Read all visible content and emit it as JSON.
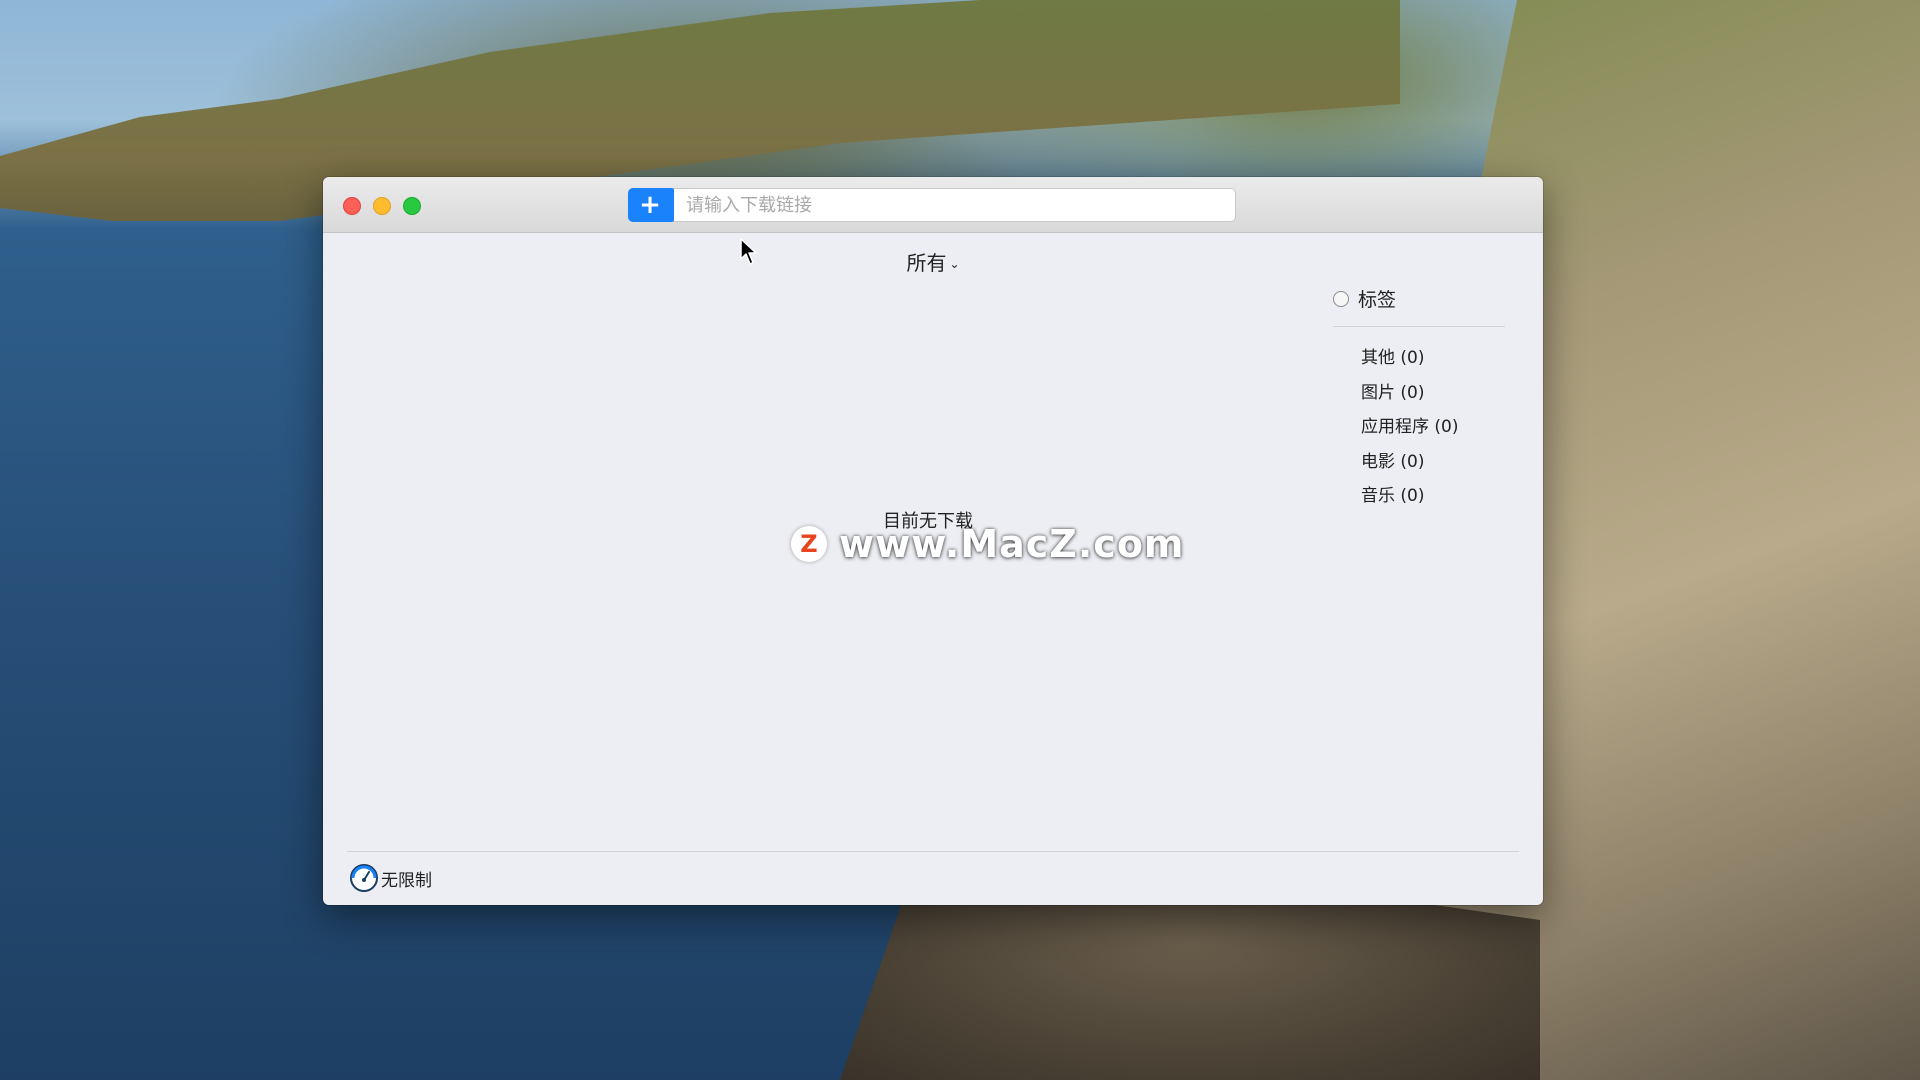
{
  "app": {
    "input_placeholder": "请输入下载链接",
    "filter_label": "所有",
    "empty_message": "目前无下载",
    "speed_label": "无限制",
    "accent_color": "#1a82fb"
  },
  "sidebar": {
    "header": "标签",
    "items": [
      {
        "label": "其他 (0)"
      },
      {
        "label": "图片 (0)"
      },
      {
        "label": "应用程序 (0)"
      },
      {
        "label": "电影 (0)"
      },
      {
        "label": "音乐 (0)"
      }
    ]
  },
  "watermark": {
    "logo_letter": "Z",
    "text": "www.MacZ.com"
  }
}
